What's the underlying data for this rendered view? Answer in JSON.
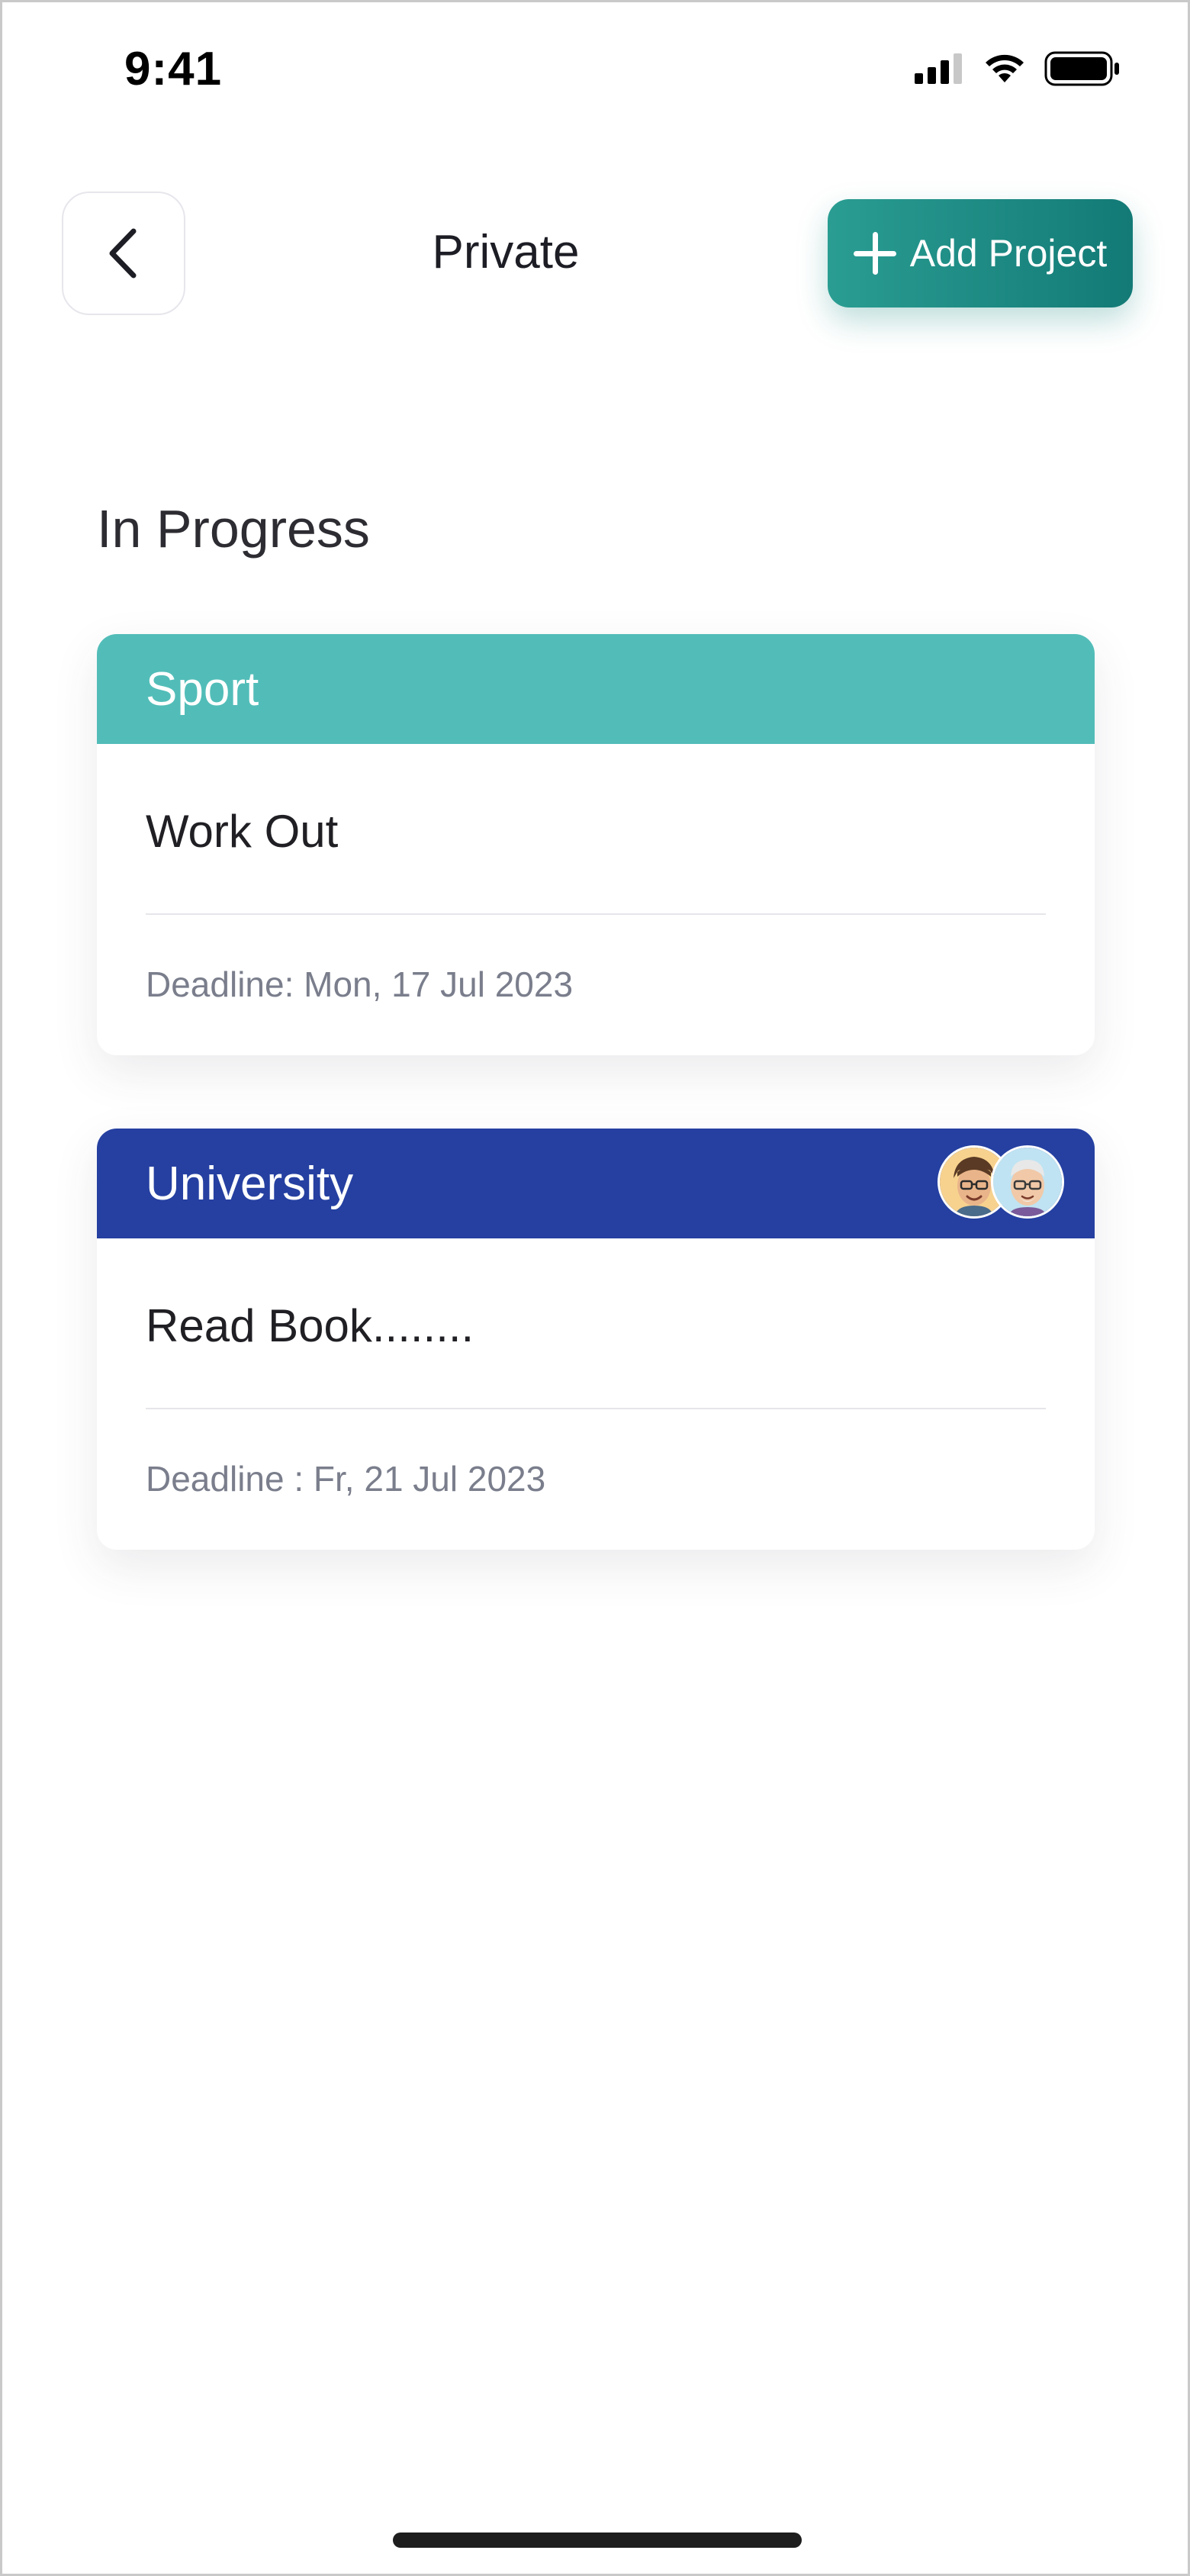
{
  "status_bar": {
    "time": "9:41"
  },
  "header": {
    "title": "Private",
    "add_button_label": "Add Project"
  },
  "section": {
    "title": "In Progress"
  },
  "projects": [
    {
      "category": "Sport",
      "task": "Work Out",
      "deadline": "Deadline: Mon, 17 Jul 2023",
      "color": "#52bdb8"
    },
    {
      "category": "University",
      "task": "Read Book........",
      "deadline": "Deadline : Fr, 21 Jul 2023",
      "color": "#2540a1"
    }
  ],
  "colors": {
    "accent": "#1a8a80",
    "text_muted": "#7a7e8c"
  }
}
